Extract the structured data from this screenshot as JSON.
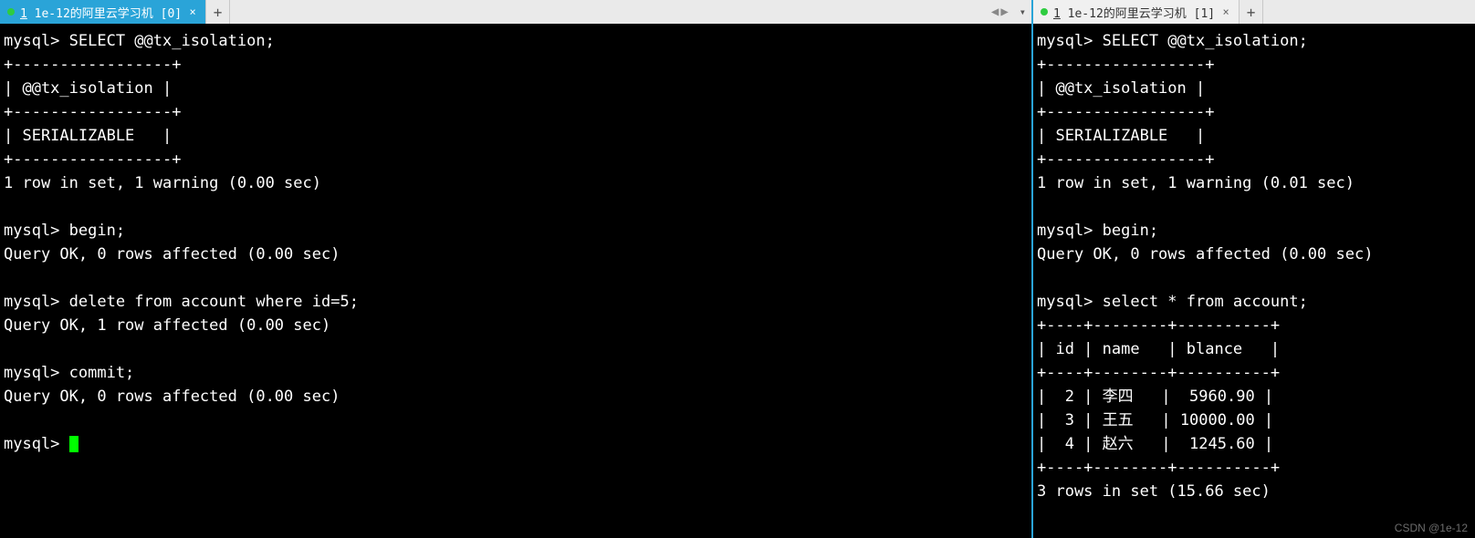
{
  "left": {
    "tab": {
      "prefix": "1",
      "title": " 1e-12的阿里云学习机 [0]",
      "close": "×"
    },
    "newtab": "+",
    "arrows": {
      "prev": "◀",
      "next": "▶"
    },
    "dropdown": "▾",
    "lines": [
      "mysql> SELECT @@tx_isolation;",
      "+-----------------+",
      "| @@tx_isolation |",
      "+-----------------+",
      "| SERIALIZABLE   |",
      "+-----------------+",
      "1 row in set, 1 warning (0.00 sec)",
      "",
      "mysql> begin;",
      "Query OK, 0 rows affected (0.00 sec)",
      "",
      "mysql> delete from account where id=5;",
      "Query OK, 1 row affected (0.00 sec)",
      "",
      "mysql> commit;",
      "Query OK, 0 rows affected (0.00 sec)",
      "",
      "mysql> "
    ]
  },
  "right": {
    "tab": {
      "prefix": "1",
      "title": " 1e-12的阿里云学习机 [1]",
      "close": "×"
    },
    "newtab": "+",
    "lines": [
      "mysql> SELECT @@tx_isolation;",
      "+-----------------+",
      "| @@tx_isolation |",
      "+-----------------+",
      "| SERIALIZABLE   |",
      "+-----------------+",
      "1 row in set, 1 warning (0.01 sec)",
      "",
      "mysql> begin;",
      "Query OK, 0 rows affected (0.00 sec)",
      "",
      "mysql> select * from account;",
      "+----+--------+----------+",
      "| id | name   | blance   |",
      "+----+--------+----------+",
      "|  2 | 李四   |  5960.90 |",
      "|  3 | 王五   | 10000.00 |",
      "|  4 | 赵六   |  1245.60 |",
      "+----+--------+----------+",
      "3 rows in set (15.66 sec)"
    ],
    "watermark": "CSDN @1e-12"
  }
}
